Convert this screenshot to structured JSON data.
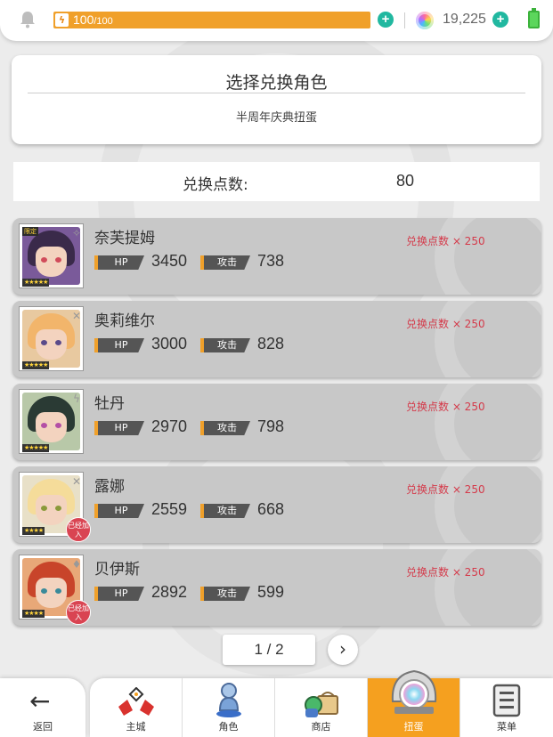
{
  "status_bar": {
    "stamina_current": "100",
    "stamina_max": "/100",
    "stamina_percent": 100,
    "gems": "19,225"
  },
  "header": {
    "title": "选择兑换角色",
    "subtitle": "半周年庆典扭蛋"
  },
  "points": {
    "label": "兑换点数:",
    "value": "80"
  },
  "stat_labels": {
    "hp": "HP",
    "attack": "攻击"
  },
  "characters": [
    {
      "name": "奈芙提姆",
      "hp": "3450",
      "attack": "738",
      "cost": "兑换点数 × 250",
      "stars": "★★★★★",
      "tag": "限定",
      "joined": "",
      "hair": "#3a2a4a",
      "eye": "#d14b5a",
      "elem": "✧",
      "bg": "#7a5a9a"
    },
    {
      "name": "奥莉维尔",
      "hp": "3000",
      "attack": "828",
      "cost": "兑换点数 × 250",
      "stars": "★★★★★",
      "tag": "",
      "joined": "",
      "hair": "#f2b56b",
      "eye": "#5a4a8a",
      "elem": "✕",
      "bg": "#e8c9a0"
    },
    {
      "name": "牡丹",
      "hp": "2970",
      "attack": "798",
      "cost": "兑换点数 × 250",
      "stars": "★★★★★",
      "tag": "",
      "joined": "",
      "hair": "#2a3a34",
      "eye": "#b44fa6",
      "elem": "ϟ",
      "bg": "#b8c8a8"
    },
    {
      "name": "露娜",
      "hp": "2559",
      "attack": "668",
      "cost": "兑换点数 × 250",
      "stars": "★★★★",
      "tag": "",
      "joined": "已经加入",
      "hair": "#f5dc9a",
      "eye": "#8a9a3a",
      "elem": "✕",
      "bg": "#e8e0c8"
    },
    {
      "name": "贝伊斯",
      "hp": "2892",
      "attack": "599",
      "cost": "兑换点数 × 250",
      "stars": "★★★★",
      "tag": "",
      "joined": "已经加入",
      "hair": "#c8442a",
      "eye": "#3a8a9a",
      "elem": "♦",
      "bg": "#e8a878"
    }
  ],
  "pagination": {
    "page": "1 / 2",
    "next_icon": "chevron-right-icon"
  },
  "nav": {
    "back_label": "返回",
    "items": [
      {
        "label": "主城",
        "icon": "castle-icon"
      },
      {
        "label": "角色",
        "icon": "character-icon"
      },
      {
        "label": "商店",
        "icon": "shop-icon"
      },
      {
        "label": "扭蛋",
        "icon": "gacha-icon"
      },
      {
        "label": "菜单",
        "icon": "menu-icon"
      }
    ],
    "active": "扭蛋"
  },
  "colors": {
    "accent": "#f5a01f",
    "stamina": "#f0a02a",
    "plus": "#21b8a0",
    "cost_text": "#d43a4a",
    "row_bg": "#c8c8c8"
  }
}
